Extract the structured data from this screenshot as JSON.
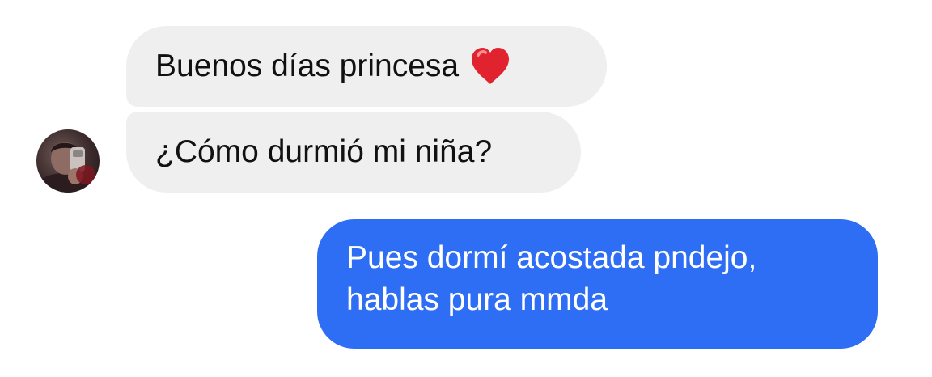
{
  "messages": [
    {
      "sender": "them",
      "text": "Buenos días princesa",
      "emoji": "heart"
    },
    {
      "sender": "them",
      "text": "¿Cómo durmió mi niña?"
    },
    {
      "sender": "me",
      "lines": [
        "Pues dormí acostada pndejo,",
        "hablas pura mmda"
      ]
    }
  ],
  "colors": {
    "incoming_bubble": "#efeff0",
    "outgoing_bubble": "#2e6ef5",
    "heart": "#e0232f"
  },
  "icons": {
    "heart": "heart-icon",
    "avatar": "avatar"
  }
}
